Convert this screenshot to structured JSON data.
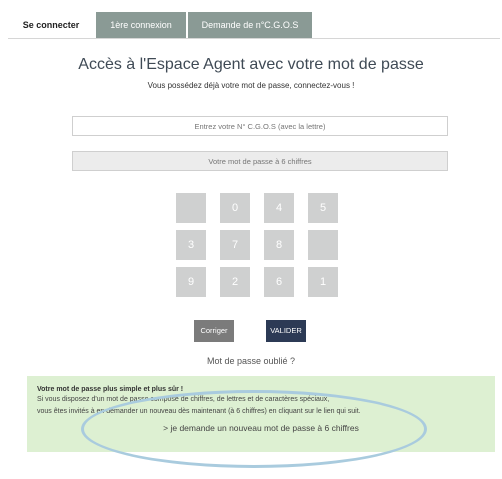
{
  "tabs": [
    "Se connecter",
    "1ère connexion",
    "Demande de n°C.G.O.S"
  ],
  "title": "Accès à l'Espace Agent avec votre mot de passe",
  "subtitle": "Vous possédez déjà votre mot de passe, connectez-vous !",
  "id_field": {
    "placeholder": "Entrez votre N° C.G.O.S (avec la lettre)"
  },
  "password_field": {
    "placeholder": "Votre mot de passe à 6 chiffres"
  },
  "keypad": [
    "",
    "0",
    "4",
    "5",
    "3",
    "7",
    "8",
    "",
    "9",
    "2",
    "6",
    "1"
  ],
  "buttons": {
    "correct": "Corriger",
    "validate": "VALIDER"
  },
  "forgot_link": "Mot de passe oublié ?",
  "notice": {
    "title": "Votre mot de passe plus simple et plus sûr !",
    "line1": "Si vous disposez d'un mot de passe composé de chiffres, de lettres et de caractères spéciaux,",
    "line2": "vous êtes invités à en demander un nouveau dès maintenant (à 6 chiffres) en cliquant sur le lien qui suit.",
    "link": "> je demande un nouveau mot de passe à 6 chiffres"
  },
  "colors": {
    "tab_inactive": "#8a9a95",
    "validate": "#2c3a55",
    "notice_bg": "#ddf0d2",
    "highlight": "#a9cbde"
  }
}
